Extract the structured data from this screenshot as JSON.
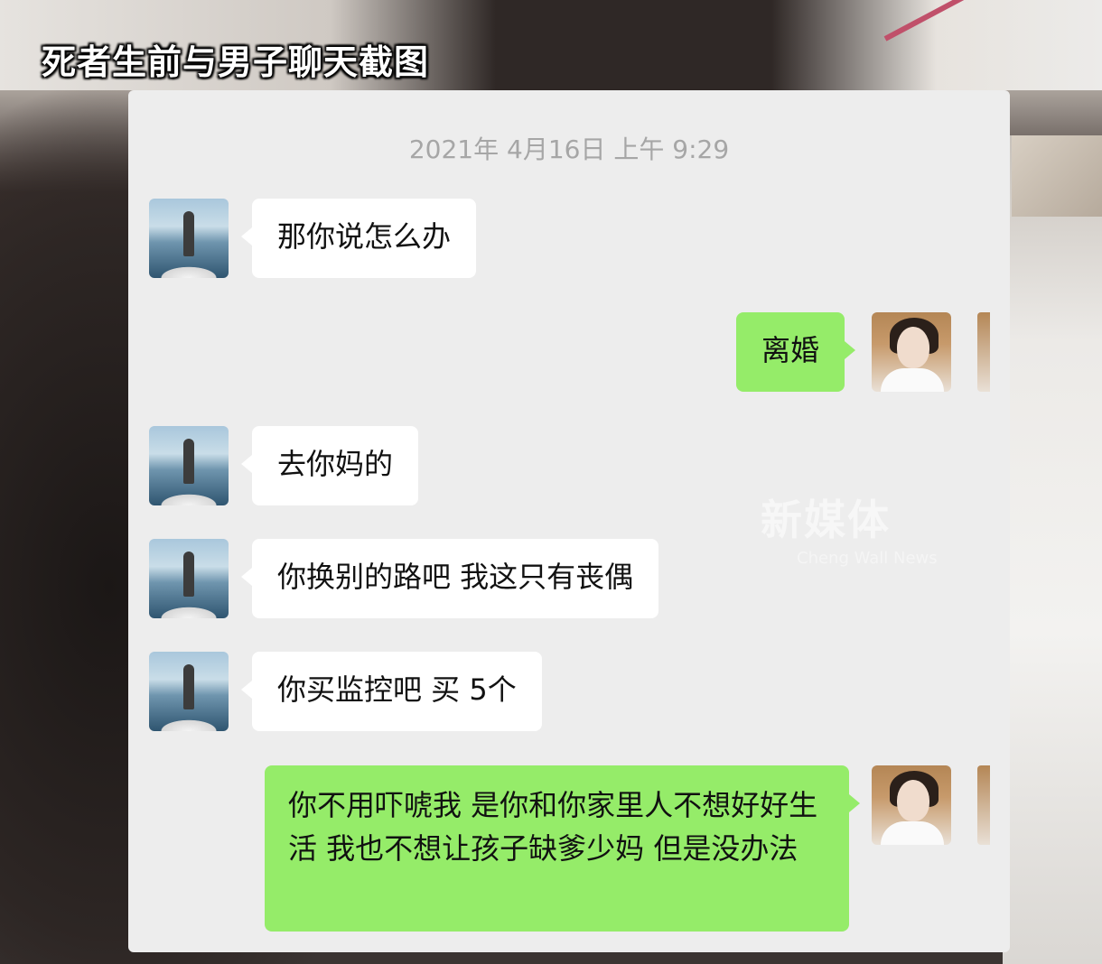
{
  "overlay": {
    "caption": "死者生前与男子聊天截图",
    "watermark": "新媒体",
    "watermark_sub": "Cheng Wall News"
  },
  "chat": {
    "timestamp": "2021年 4月16日 上午 9:29",
    "messages": [
      {
        "side": "left",
        "text": "那你说怎么办"
      },
      {
        "side": "right",
        "text": "离婚"
      },
      {
        "side": "left",
        "text": "去你妈的"
      },
      {
        "side": "left",
        "text": "你换别的路吧 我这只有丧偶"
      },
      {
        "side": "left",
        "text": "你买监控吧 买 5个"
      },
      {
        "side": "right",
        "text": "你不用吓唬我 是你和你家里人不想好好生活 我也不想让孩子缺爹少妈 但是没办法"
      }
    ]
  },
  "colors": {
    "chat_background": "#ededed",
    "incoming_bubble": "#ffffff",
    "outgoing_bubble": "#95ec69",
    "timestamp_text": "#a6a6a6"
  },
  "icons": {
    "incoming_avatar": "male-on-boat-avatar",
    "outgoing_avatar": "female-portrait-avatar"
  }
}
